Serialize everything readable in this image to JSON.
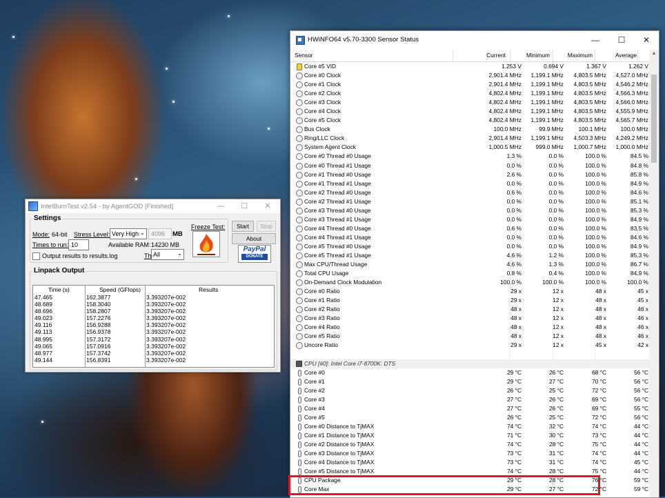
{
  "intelburntest": {
    "title": "IntelBurnTest v2.54 - by AgentGOD [Finished]",
    "settings_label": "Settings",
    "mode_label": "Mode:",
    "mode_value": "64-bit",
    "stress_label": "Stress Level:",
    "stress_value": "Very High",
    "mb_value": "4096",
    "mb_unit": "MB",
    "times_label": "Times to run:",
    "times_value": "10",
    "ram_label": "Available RAM:",
    "ram_value": "14230 MB",
    "threads_label": "Threads:",
    "threads_value": "All",
    "output_checkbox_label": "Output results to results.log",
    "freeze_label": "Freeze Test:",
    "start_label": "Start",
    "stop_label": "Stop",
    "about_label": "About",
    "paypal_label": "PayPal",
    "donate_label": "DONATE",
    "linpack_label": "Linpack Output",
    "columns": [
      "Time (s)",
      "Speed (GFlops)",
      "Results"
    ],
    "times": [
      "47.465",
      "48.689",
      "48.696",
      "49.023",
      "49.116",
      "49.113",
      "48.995",
      "49.065",
      "48.977",
      "49.144"
    ],
    "speeds": [
      "162.3877",
      "158.3040",
      "158.2807",
      "157.2276",
      "156.9288",
      "156.9378",
      "157.3172",
      "157.0916",
      "157.3742",
      "156.8391"
    ],
    "results": [
      "3.393207e-002",
      "3.393207e-002",
      "3.393207e-002",
      "3.393207e-002",
      "3.393207e-002",
      "3.393207e-002",
      "3.393207e-002",
      "3.393207e-002",
      "3.393207e-002",
      "3.393207e-002"
    ]
  },
  "hwinfo": {
    "title": "HWiNFO64 v5.70-3300 Sensor Status",
    "columns": [
      "Sensor",
      "Current",
      "Minimum",
      "Maximum",
      "Average"
    ],
    "rows": [
      {
        "icon": "vid",
        "name": "Core #5 VID",
        "cur": "1.253 V",
        "min": "0.694 V",
        "max": "1.367 V",
        "avg": "1.262 V"
      },
      {
        "icon": "circle",
        "name": "Core #0 Clock",
        "cur": "2,901.4 MHz",
        "min": "1,199.1 MHz",
        "max": "4,803.5 MHz",
        "avg": "4,527.0 MHz"
      },
      {
        "icon": "circle",
        "name": "Core #1 Clock",
        "cur": "2,901.4 MHz",
        "min": "1,199.1 MHz",
        "max": "4,803.5 MHz",
        "avg": "4,546.2 MHz"
      },
      {
        "icon": "circle",
        "name": "Core #2 Clock",
        "cur": "4,802.4 MHz",
        "min": "1,199.1 MHz",
        "max": "4,803.5 MHz",
        "avg": "4,566.3 MHz"
      },
      {
        "icon": "circle",
        "name": "Core #3 Clock",
        "cur": "4,802.4 MHz",
        "min": "1,199.1 MHz",
        "max": "4,803.5 MHz",
        "avg": "4,566.0 MHz"
      },
      {
        "icon": "circle",
        "name": "Core #4 Clock",
        "cur": "4,802.4 MHz",
        "min": "1,199.1 MHz",
        "max": "4,803.5 MHz",
        "avg": "4,555.9 MHz"
      },
      {
        "icon": "circle",
        "name": "Core #5 Clock",
        "cur": "4,802.4 MHz",
        "min": "1,199.1 MHz",
        "max": "4,803.5 MHz",
        "avg": "4,565.7 MHz"
      },
      {
        "icon": "circle",
        "name": "Bus Clock",
        "cur": "100.0 MHz",
        "min": "99.9 MHz",
        "max": "100.1 MHz",
        "avg": "100.0 MHz"
      },
      {
        "icon": "circle",
        "name": "Ring/LLC Clock",
        "cur": "2,901.4 MHz",
        "min": "1,199.1 MHz",
        "max": "4,503.3 MHz",
        "avg": "4,249.2 MHz"
      },
      {
        "icon": "circle",
        "name": "System Agent Clock",
        "cur": "1,000.5 MHz",
        "min": "999.0 MHz",
        "max": "1,000.7 MHz",
        "avg": "1,000.0 MHz"
      },
      {
        "icon": "circle",
        "name": "Core #0 Thread #0 Usage",
        "cur": "1.3 %",
        "min": "0.0 %",
        "max": "100.0 %",
        "avg": "84.5 %"
      },
      {
        "icon": "circle",
        "name": "Core #0 Thread #1 Usage",
        "cur": "0.0 %",
        "min": "0.0 %",
        "max": "100.0 %",
        "avg": "84.8 %"
      },
      {
        "icon": "circle",
        "name": "Core #1 Thread #0 Usage",
        "cur": "2.6 %",
        "min": "0.0 %",
        "max": "100.0 %",
        "avg": "85.8 %"
      },
      {
        "icon": "circle",
        "name": "Core #1 Thread #1 Usage",
        "cur": "0.0 %",
        "min": "0.0 %",
        "max": "100.0 %",
        "avg": "84.9 %"
      },
      {
        "icon": "circle",
        "name": "Core #2 Thread #0 Usage",
        "cur": "0.6 %",
        "min": "0.0 %",
        "max": "100.0 %",
        "avg": "84.6 %"
      },
      {
        "icon": "circle",
        "name": "Core #2 Thread #1 Usage",
        "cur": "0.0 %",
        "min": "0.0 %",
        "max": "100.0 %",
        "avg": "85.1 %"
      },
      {
        "icon": "circle",
        "name": "Core #3 Thread #0 Usage",
        "cur": "0.0 %",
        "min": "0.0 %",
        "max": "100.0 %",
        "avg": "85.3 %"
      },
      {
        "icon": "circle",
        "name": "Core #3 Thread #1 Usage",
        "cur": "0.0 %",
        "min": "0.0 %",
        "max": "100.0 %",
        "avg": "84.9 %"
      },
      {
        "icon": "circle",
        "name": "Core #4 Thread #0 Usage",
        "cur": "0.6 %",
        "min": "0.0 %",
        "max": "100.0 %",
        "avg": "83.5 %"
      },
      {
        "icon": "circle",
        "name": "Core #4 Thread #1 Usage",
        "cur": "0.0 %",
        "min": "0.0 %",
        "max": "100.0 %",
        "avg": "84.6 %"
      },
      {
        "icon": "circle",
        "name": "Core #5 Thread #0 Usage",
        "cur": "0.0 %",
        "min": "0.0 %",
        "max": "100.0 %",
        "avg": "84.9 %"
      },
      {
        "icon": "circle",
        "name": "Core #5 Thread #1 Usage",
        "cur": "4.6 %",
        "min": "1.2 %",
        "max": "100.0 %",
        "avg": "85.3 %"
      },
      {
        "icon": "circle",
        "name": "Max CPU/Thread Usage",
        "cur": "4.6 %",
        "min": "1.3 %",
        "max": "100.0 %",
        "avg": "86.7 %"
      },
      {
        "icon": "circle",
        "name": "Total CPU Usage",
        "cur": "0.8 %",
        "min": "0.4 %",
        "max": "100.0 %",
        "avg": "84.9 %"
      },
      {
        "icon": "circle",
        "name": "On-Demand Clock Modulation",
        "cur": "100.0 %",
        "min": "100.0 %",
        "max": "100.0 %",
        "avg": "100.0 %"
      },
      {
        "icon": "circle",
        "name": "Core #0 Ratio",
        "cur": "29 x",
        "min": "12 x",
        "max": "48 x",
        "avg": "45 x"
      },
      {
        "icon": "circle",
        "name": "Core #1 Ratio",
        "cur": "29 x",
        "min": "12 x",
        "max": "48 x",
        "avg": "45 x"
      },
      {
        "icon": "circle",
        "name": "Core #2 Ratio",
        "cur": "48 x",
        "min": "12 x",
        "max": "48 x",
        "avg": "46 x"
      },
      {
        "icon": "circle",
        "name": "Core #3 Ratio",
        "cur": "48 x",
        "min": "12 x",
        "max": "48 x",
        "avg": "46 x"
      },
      {
        "icon": "circle",
        "name": "Core #4 Ratio",
        "cur": "48 x",
        "min": "12 x",
        "max": "48 x",
        "avg": "46 x"
      },
      {
        "icon": "circle",
        "name": "Core #5 Ratio",
        "cur": "48 x",
        "min": "12 x",
        "max": "48 x",
        "avg": "46 x"
      },
      {
        "icon": "circle",
        "name": "Uncore Ratio",
        "cur": "29 x",
        "min": "12 x",
        "max": "45 x",
        "avg": "42 x"
      },
      {
        "icon": "blank",
        "name": "",
        "cur": "",
        "min": "",
        "max": "",
        "avg": ""
      },
      {
        "icon": "chip",
        "name": "CPU [#0]: Intel Core i7-8700K: DTS",
        "cur": "",
        "min": "",
        "max": "",
        "avg": "",
        "group": true
      },
      {
        "icon": "temp",
        "name": "Core #0",
        "cur": "29 °C",
        "min": "26 °C",
        "max": "68 °C",
        "avg": "56 °C"
      },
      {
        "icon": "temp",
        "name": "Core #1",
        "cur": "29 °C",
        "min": "27 °C",
        "max": "70 °C",
        "avg": "56 °C"
      },
      {
        "icon": "temp",
        "name": "Core #2",
        "cur": "26 °C",
        "min": "25 °C",
        "max": "72 °C",
        "avg": "56 °C"
      },
      {
        "icon": "temp",
        "name": "Core #3",
        "cur": "27 °C",
        "min": "26 °C",
        "max": "69 °C",
        "avg": "56 °C"
      },
      {
        "icon": "temp",
        "name": "Core #4",
        "cur": "27 °C",
        "min": "26 °C",
        "max": "69 °C",
        "avg": "55 °C"
      },
      {
        "icon": "temp",
        "name": "Core #5",
        "cur": "26 °C",
        "min": "25 °C",
        "max": "72 °C",
        "avg": "56 °C"
      },
      {
        "icon": "temp",
        "name": "Core #0 Distance to TjMAX",
        "cur": "74 °C",
        "min": "32 °C",
        "max": "74 °C",
        "avg": "44 °C"
      },
      {
        "icon": "temp",
        "name": "Core #1 Distance to TjMAX",
        "cur": "71 °C",
        "min": "30 °C",
        "max": "73 °C",
        "avg": "44 °C"
      },
      {
        "icon": "temp",
        "name": "Core #2 Distance to TjMAX",
        "cur": "74 °C",
        "min": "28 °C",
        "max": "75 °C",
        "avg": "44 °C"
      },
      {
        "icon": "temp",
        "name": "Core #3 Distance to TjMAX",
        "cur": "73 °C",
        "min": "31 °C",
        "max": "74 °C",
        "avg": "44 °C"
      },
      {
        "icon": "temp",
        "name": "Core #4 Distance to TjMAX",
        "cur": "73 °C",
        "min": "31 °C",
        "max": "74 °C",
        "avg": "45 °C"
      },
      {
        "icon": "temp",
        "name": "Core #5 Distance to TjMAX",
        "cur": "74 °C",
        "min": "28 °C",
        "max": "75 °C",
        "avg": "44 °C"
      },
      {
        "icon": "temp",
        "name": "CPU Package",
        "cur": "29 °C",
        "min": "28 °C",
        "max": "76 °C",
        "avg": "59 °C"
      },
      {
        "icon": "temp",
        "name": "Core Max",
        "cur": "29 °C",
        "min": "27 °C",
        "max": "72 °C",
        "avg": "59 °C"
      }
    ]
  },
  "colors": {
    "highlight_box": "#e0151e",
    "hwinfo_group_row": "#f0f0f0"
  }
}
